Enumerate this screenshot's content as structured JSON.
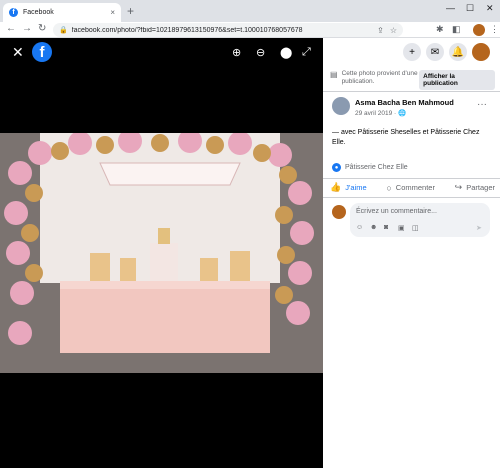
{
  "browser": {
    "tab_title": "Facebook",
    "tab_favicon": "f",
    "tab_close": "×",
    "new_tab": "+",
    "window_controls": [
      "—",
      "☐",
      "✕"
    ],
    "back": "←",
    "forward": "→",
    "reload": "↻",
    "url": "facebook.com/photo/?fbid=102189796131509​76&set=t.100010768057678",
    "toolbar_icons": [
      "⇪",
      "☆",
      "✱",
      "◧",
      "▭"
    ],
    "menu": "⋮"
  },
  "viewer": {
    "close": "✕",
    "logo": "f",
    "tools": [
      "⊕",
      "⊖",
      "⬤",
      "⤢"
    ]
  },
  "header": {
    "buttons": [
      "+",
      "✉",
      "🔔"
    ]
  },
  "post": {
    "notice_text": "Cette photo provient d'une publication.",
    "notice_button": "Afficher la publication",
    "author": "Asma Bacha Ben Mahmoud",
    "date": "29 avril 2019 · 🌐",
    "more": "···",
    "caption": "— avec Pâtisserie Sheselles et Pâtisserie Chez Elle.",
    "tagged": "Pâtisserie Chez Elle",
    "actions": {
      "like": "J'aime",
      "comment": "Commenter",
      "share": "Partager"
    },
    "comment_placeholder": "Écrivez un commentaire..."
  },
  "colors": {
    "accent": "#1877f2",
    "viewer_bg": "#000000"
  }
}
